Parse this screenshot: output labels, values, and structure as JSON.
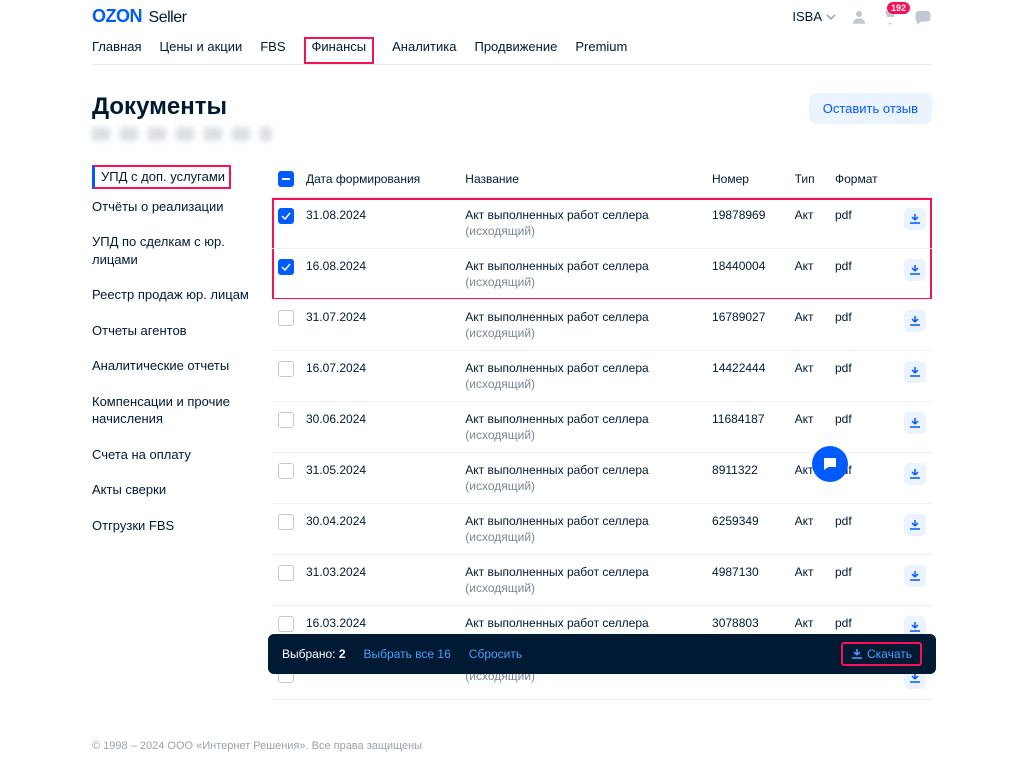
{
  "logo": {
    "brand": "OZON",
    "suffix": "Seller"
  },
  "account_name": "ISBA",
  "notifications_count": "192",
  "nav": [
    "Главная",
    "Цены и акции",
    "FBS",
    "Финансы",
    "Аналитика",
    "Продвижение",
    "Premium"
  ],
  "nav_highlighted_index": 3,
  "page_title": "Документы",
  "feedback_label": "Оставить отзыв",
  "sidebar": {
    "items": [
      "УПД с доп. услугами",
      "Отчёты о реализации",
      "УПД по сделкам с юр. лицами",
      "Реестр продаж юр. лицам",
      "Отчеты агентов",
      "Аналитические отчеты",
      "Компенсации и прочие начисления",
      "Счета на оплату",
      "Акты сверки",
      "Отгрузки FBS"
    ],
    "active_index": 0
  },
  "table": {
    "headers": [
      "Дата формирования",
      "Название",
      "Номер",
      "Тип",
      "Формат"
    ],
    "rows": [
      {
        "checked": true,
        "date": "31.08.2024",
        "name": "Акт выполненных работ селлера",
        "sub": "(исходящий)",
        "num": "19878969",
        "type": "Акт",
        "fmt": "pdf"
      },
      {
        "checked": true,
        "date": "16.08.2024",
        "name": "Акт выполненных работ селлера",
        "sub": "(исходящий)",
        "num": "18440004",
        "type": "Акт",
        "fmt": "pdf"
      },
      {
        "checked": false,
        "date": "31.07.2024",
        "name": "Акт выполненных работ селлера",
        "sub": "(исходящий)",
        "num": "16789027",
        "type": "Акт",
        "fmt": "pdf"
      },
      {
        "checked": false,
        "date": "16.07.2024",
        "name": "Акт выполненных работ селлера",
        "sub": "(исходящий)",
        "num": "14422444",
        "type": "Акт",
        "fmt": "pdf"
      },
      {
        "checked": false,
        "date": "30.06.2024",
        "name": "Акт выполненных работ селлера",
        "sub": "(исходящий)",
        "num": "11684187",
        "type": "Акт",
        "fmt": "pdf"
      },
      {
        "checked": false,
        "date": "31.05.2024",
        "name": "Акт выполненных работ селлера",
        "sub": "(исходящий)",
        "num": "8911322",
        "type": "Акт",
        "fmt": "pdf"
      },
      {
        "checked": false,
        "date": "30.04.2024",
        "name": "Акт выполненных работ селлера",
        "sub": "(исходящий)",
        "num": "6259349",
        "type": "Акт",
        "fmt": "pdf"
      },
      {
        "checked": false,
        "date": "31.03.2024",
        "name": "Акт выполненных работ селлера",
        "sub": "(исходящий)",
        "num": "4987130",
        "type": "Акт",
        "fmt": "pdf"
      },
      {
        "checked": false,
        "date": "16.03.2024",
        "name": "Акт выполненных работ селлера",
        "sub": "(исходящий)",
        "num": "3078803",
        "type": "Акт",
        "fmt": "pdf"
      },
      {
        "checked": false,
        "date": "",
        "name": "",
        "sub": "(исходящий)",
        "num": "",
        "type": "",
        "fmt": ""
      }
    ],
    "highlight_first_n": 2
  },
  "selbar": {
    "selected_label": "Выбрано:",
    "selected_count": "2",
    "select_all": "Выбрать все 16",
    "reset": "Сбросить",
    "download": "Скачать"
  },
  "footer": "© 1998 – 2024 ООО «Интернет Решения». Все права защищены"
}
